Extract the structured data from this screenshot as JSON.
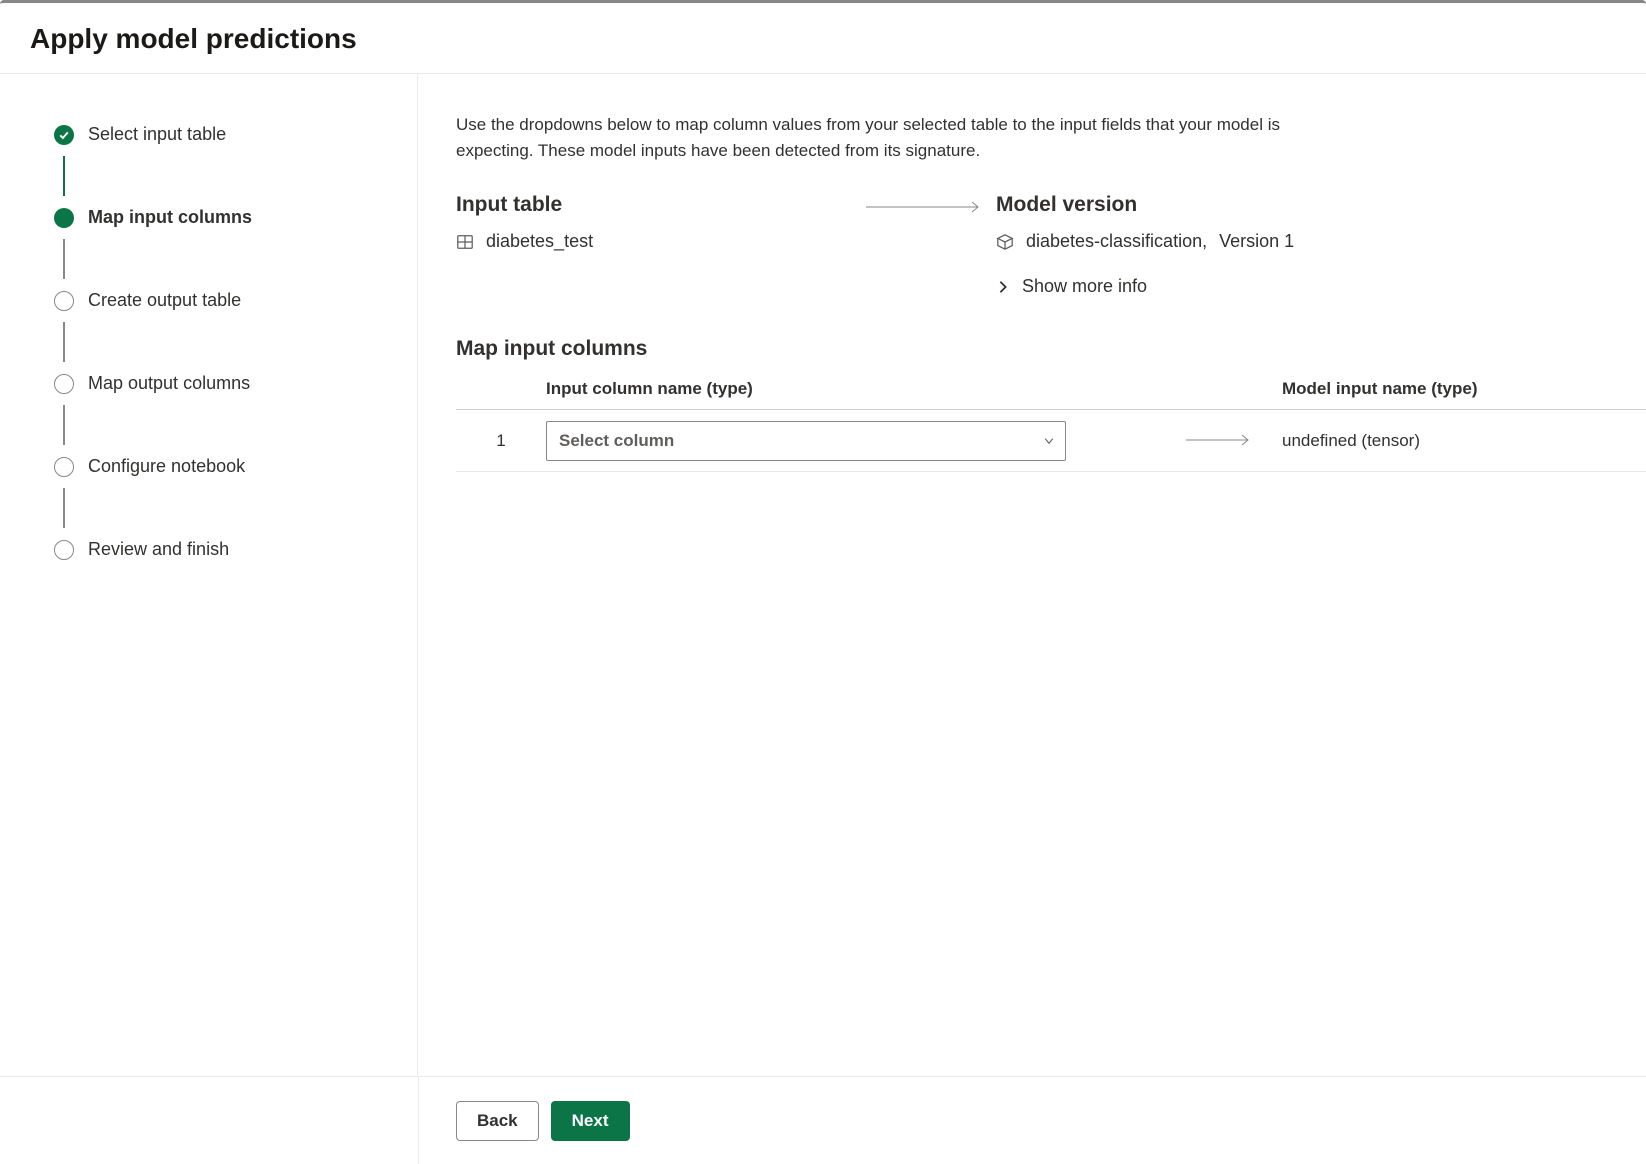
{
  "dialog": {
    "title": "Apply model predictions"
  },
  "stepper": {
    "steps": [
      {
        "label": "Select input table",
        "state": "completed"
      },
      {
        "label": "Map input columns",
        "state": "current"
      },
      {
        "label": "Create output table",
        "state": "pending"
      },
      {
        "label": "Map output columns",
        "state": "pending"
      },
      {
        "label": "Configure notebook",
        "state": "pending"
      },
      {
        "label": "Review and finish",
        "state": "pending"
      }
    ]
  },
  "content": {
    "description": "Use the dropdowns below to map column values from your selected table to the input fields that your model is expecting. These model inputs have been detected from its signature.",
    "input_table": {
      "heading": "Input table",
      "value": "diabetes_test"
    },
    "model_version": {
      "heading": "Model version",
      "name": "diabetes-classification,",
      "version": "Version 1",
      "show_more": "Show more info"
    },
    "map": {
      "heading": "Map input columns",
      "headers": {
        "input": "Input column name (type)",
        "model": "Model input name (type)"
      },
      "rows": [
        {
          "index": "1",
          "select_placeholder": "Select column",
          "model_input": "undefined (tensor)"
        }
      ]
    }
  },
  "footer": {
    "back": "Back",
    "next": "Next"
  }
}
